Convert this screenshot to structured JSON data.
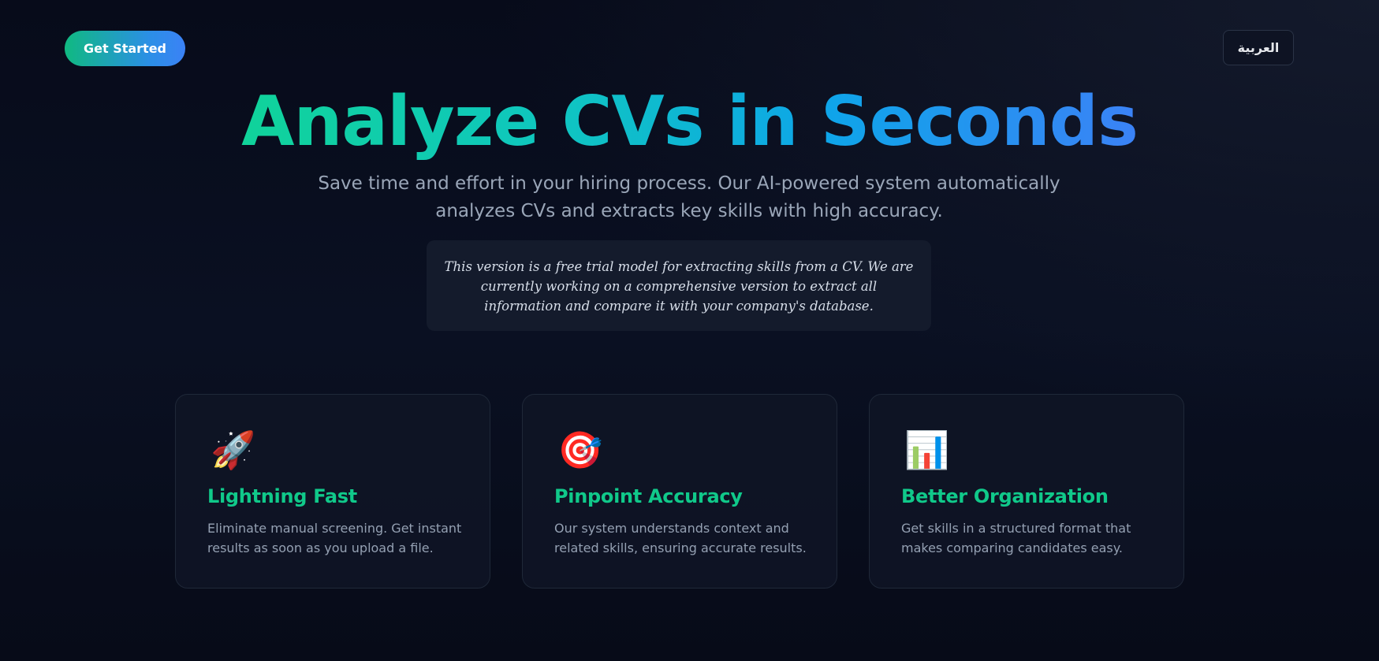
{
  "header": {
    "cta_label": "Get Started",
    "language_label": "العربية"
  },
  "hero": {
    "title": "Analyze CVs in Seconds",
    "subtitle": "Save time and effort in your hiring process. Our AI-powered system automatically analyzes CVs and extracts key skills with high accuracy.",
    "notice": "This version is a free trial model for extracting skills from a CV. We are currently working on a comprehensive version to extract all information and compare it with your company's database."
  },
  "features": [
    {
      "icon": "🚀",
      "icon_name": "rocket-icon",
      "title": "Lightning Fast",
      "description": "Eliminate manual screening. Get instant results as soon as you upload a file."
    },
    {
      "icon": "🎯",
      "icon_name": "target-icon",
      "title": "Pinpoint Accuracy",
      "description": "Our system understands context and related skills, ensuring accurate results."
    },
    {
      "icon": "📊",
      "icon_name": "bar-chart-icon",
      "title": "Better Organization",
      "description": "Get skills in a structured format that makes comparing candidates easy."
    }
  ],
  "colors": {
    "accent_green": "#10c98a",
    "accent_blue": "#3b82f6",
    "background": "#070b1a",
    "card_background": "#0f1526"
  }
}
